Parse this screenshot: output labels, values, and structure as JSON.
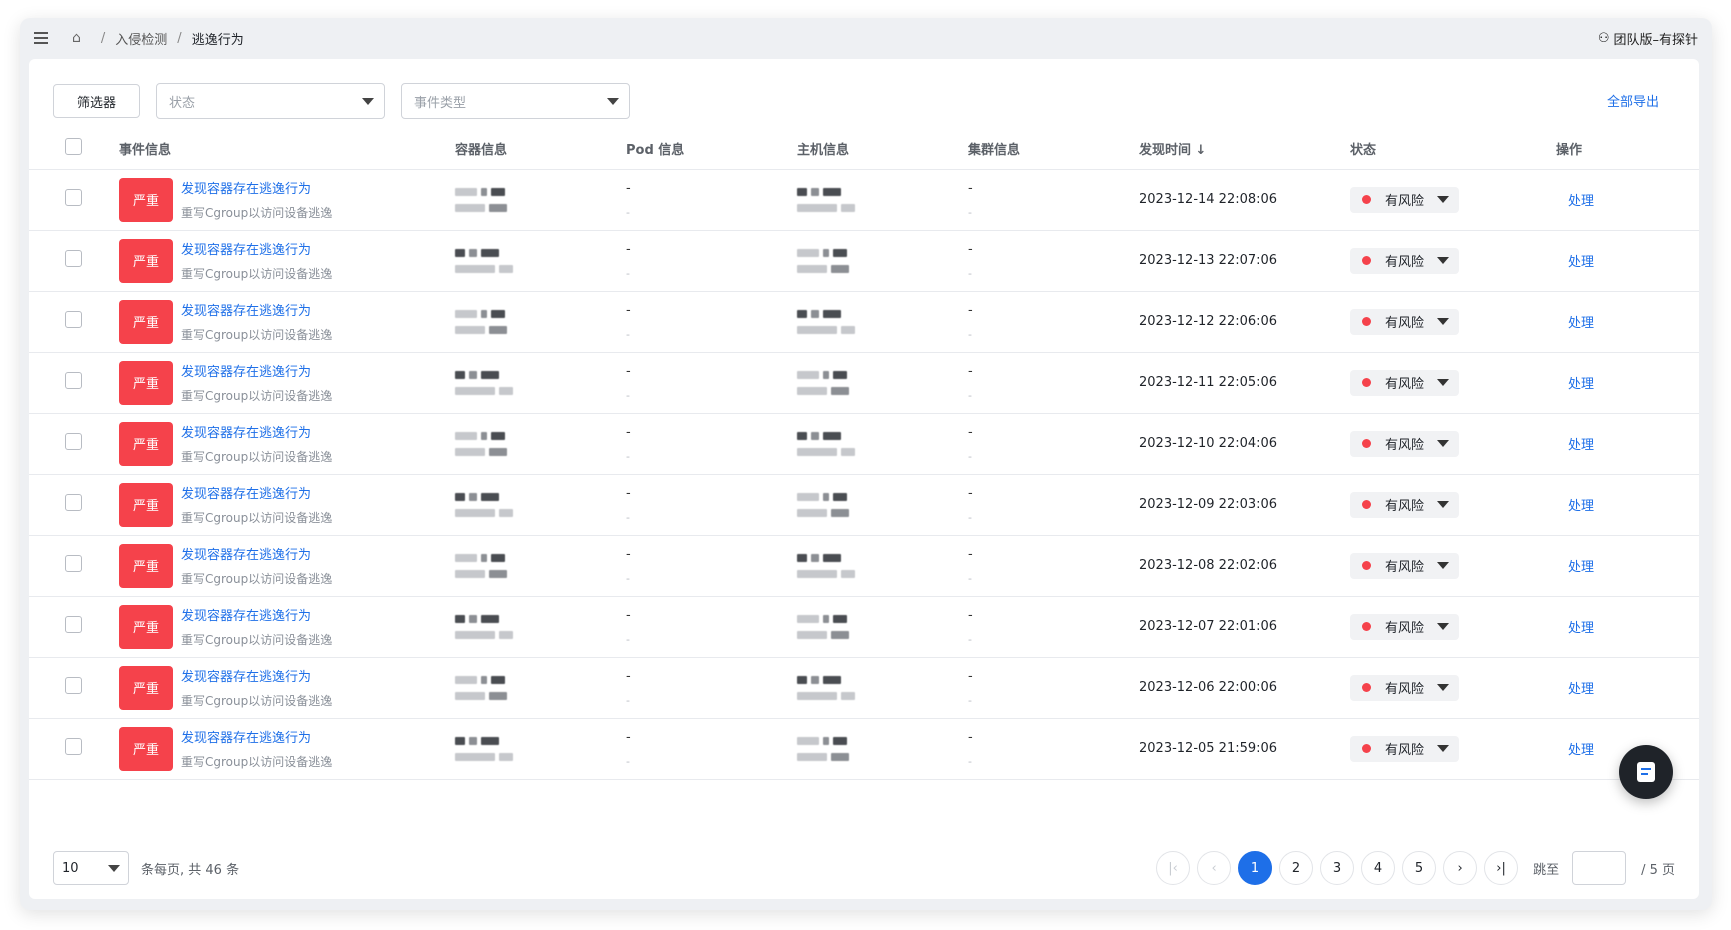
{
  "breadcrumb": {
    "items": [
      "入侵检测",
      "逃逸行为"
    ]
  },
  "user": {
    "label": "团队版–有探针"
  },
  "filters": {
    "filter_button": "筛选器",
    "status_placeholder": "状态",
    "event_type_placeholder": "事件类型",
    "export_label": "全部导出"
  },
  "table": {
    "columns": [
      "事件信息",
      "容器信息",
      "Pod 信息",
      "主机信息",
      "集群信息",
      "发现时间 ↓",
      "状态",
      "操作"
    ],
    "rows": [
      {
        "severity": "严重",
        "title": "发现容器存在逃逸行为",
        "subtitle": "重写Cgroup以访问设备逃逸",
        "pod": "-",
        "pod_sub": "-",
        "cluster": "-",
        "cluster_sub": "-",
        "time": "2023-12-14 22:08:06",
        "status": "有风险",
        "op": "处理"
      },
      {
        "severity": "严重",
        "title": "发现容器存在逃逸行为",
        "subtitle": "重写Cgroup以访问设备逃逸",
        "pod": "-",
        "pod_sub": "-",
        "cluster": "-",
        "cluster_sub": "-",
        "time": "2023-12-13 22:07:06",
        "status": "有风险",
        "op": "处理"
      },
      {
        "severity": "严重",
        "title": "发现容器存在逃逸行为",
        "subtitle": "重写Cgroup以访问设备逃逸",
        "pod": "-",
        "pod_sub": "-",
        "cluster": "-",
        "cluster_sub": "-",
        "time": "2023-12-12 22:06:06",
        "status": "有风险",
        "op": "处理"
      },
      {
        "severity": "严重",
        "title": "发现容器存在逃逸行为",
        "subtitle": "重写Cgroup以访问设备逃逸",
        "pod": "-",
        "pod_sub": "-",
        "cluster": "-",
        "cluster_sub": "-",
        "time": "2023-12-11 22:05:06",
        "status": "有风险",
        "op": "处理"
      },
      {
        "severity": "严重",
        "title": "发现容器存在逃逸行为",
        "subtitle": "重写Cgroup以访问设备逃逸",
        "pod": "-",
        "pod_sub": "-",
        "cluster": "-",
        "cluster_sub": "-",
        "time": "2023-12-10 22:04:06",
        "status": "有风险",
        "op": "处理"
      },
      {
        "severity": "严重",
        "title": "发现容器存在逃逸行为",
        "subtitle": "重写Cgroup以访问设备逃逸",
        "pod": "-",
        "pod_sub": "-",
        "cluster": "-",
        "cluster_sub": "-",
        "time": "2023-12-09 22:03:06",
        "status": "有风险",
        "op": "处理"
      },
      {
        "severity": "严重",
        "title": "发现容器存在逃逸行为",
        "subtitle": "重写Cgroup以访问设备逃逸",
        "pod": "-",
        "pod_sub": "-",
        "cluster": "-",
        "cluster_sub": "-",
        "time": "2023-12-08 22:02:06",
        "status": "有风险",
        "op": "处理"
      },
      {
        "severity": "严重",
        "title": "发现容器存在逃逸行为",
        "subtitle": "重写Cgroup以访问设备逃逸",
        "pod": "-",
        "pod_sub": "-",
        "cluster": "-",
        "cluster_sub": "-",
        "time": "2023-12-07 22:01:06",
        "status": "有风险",
        "op": "处理"
      },
      {
        "severity": "严重",
        "title": "发现容器存在逃逸行为",
        "subtitle": "重写Cgroup以访问设备逃逸",
        "pod": "-",
        "pod_sub": "-",
        "cluster": "-",
        "cluster_sub": "-",
        "time": "2023-12-06 22:00:06",
        "status": "有风险",
        "op": "处理"
      },
      {
        "severity": "严重",
        "title": "发现容器存在逃逸行为",
        "subtitle": "重写Cgroup以访问设备逃逸",
        "pod": "-",
        "pod_sub": "-",
        "cluster": "-",
        "cluster_sub": "-",
        "time": "2023-12-05 21:59:06",
        "status": "有风险",
        "op": "处理"
      }
    ]
  },
  "pagination": {
    "page_size": "10",
    "summary": "条每页, 共 46 条",
    "pages": [
      "1",
      "2",
      "3",
      "4",
      "5"
    ],
    "current_page": "1",
    "jump_label": "跳至",
    "total_pages_label": "/ 5 页"
  },
  "colors": {
    "accent": "#1e6fe8",
    "severity": "#f5424b"
  }
}
